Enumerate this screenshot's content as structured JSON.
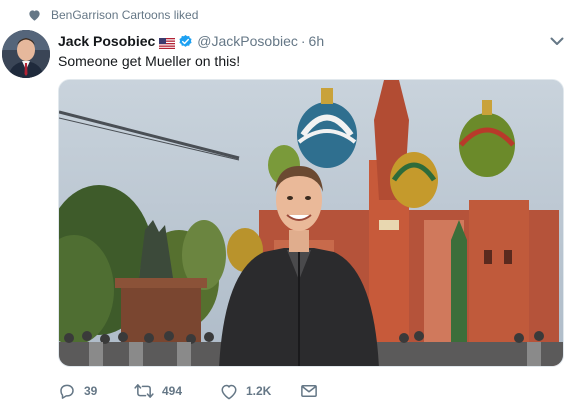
{
  "social_context": {
    "icon": "heart-icon",
    "text": "BenGarrison Cartoons liked"
  },
  "tweet": {
    "fullname": "Jack Posobiec",
    "flag_icon": "us-flag-icon",
    "verified_icon": "verified-badge-icon",
    "handle": "@JackPosobiec",
    "separator": "·",
    "time": "6h",
    "text": "Someone get Mueller on this!",
    "media_icon": "photo-red-square-moscow"
  },
  "actions": {
    "reply": {
      "icon": "reply-icon",
      "count": "39"
    },
    "retweet": {
      "icon": "retweet-icon",
      "count": "494"
    },
    "like": {
      "icon": "heart-outline-icon",
      "count": "1.2K"
    },
    "message": {
      "icon": "envelope-icon"
    }
  },
  "colors": {
    "secondary_text": "#657786",
    "primary_text": "#14171a",
    "verified_blue": "#1da1f2"
  }
}
